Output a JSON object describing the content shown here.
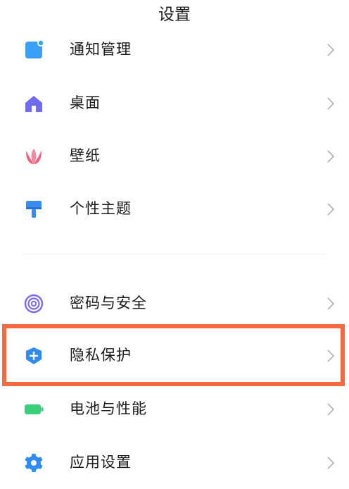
{
  "header": {
    "title": "设置"
  },
  "colors": {
    "highlight_border": "#f26a3d",
    "chevron": "#b0b0b0"
  },
  "items": [
    {
      "label": "通知管理",
      "icon": "notification-icon",
      "icon_color": "#3aa0f5"
    },
    {
      "label": "桌面",
      "icon": "home-icon",
      "icon_color": "#6f6cf0"
    },
    {
      "label": "壁纸",
      "icon": "tulip-icon",
      "icon_color": "#f0607a"
    },
    {
      "label": "个性主题",
      "icon": "paint-brush-icon",
      "icon_color": "#3a8cf0"
    },
    {
      "label": "密码与安全",
      "icon": "fingerprint-icon",
      "icon_color": "#7b6cf0"
    },
    {
      "label": "隐私保护",
      "icon": "privacy-shield-icon",
      "icon_color": "#2f8cf0",
      "highlighted": true
    },
    {
      "label": "电池与性能",
      "icon": "battery-icon",
      "icon_color": "#3ad07a"
    },
    {
      "label": "应用设置",
      "icon": "gear-icon",
      "icon_color": "#2f8cf0"
    }
  ]
}
